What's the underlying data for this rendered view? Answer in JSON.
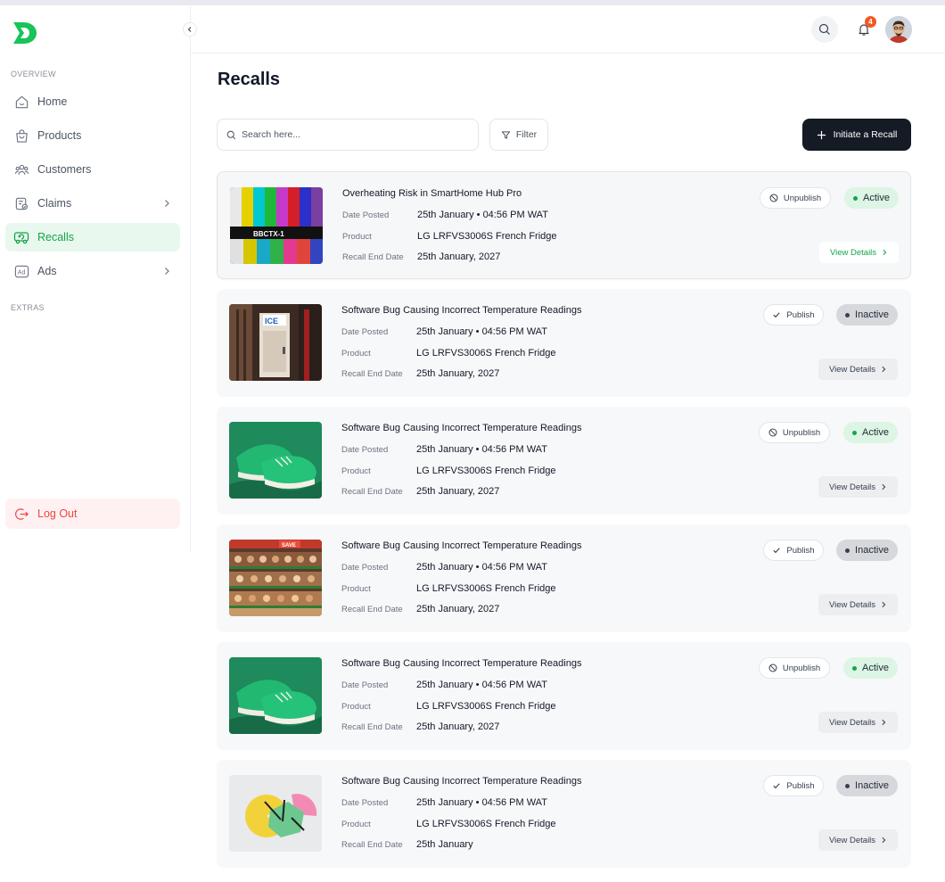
{
  "sidebar": {
    "overview_label": "OVERVIEW",
    "extras_label": "EXTRAS",
    "items": [
      {
        "label": "Home",
        "icon": "home-icon"
      },
      {
        "label": "Products",
        "icon": "bag-icon"
      },
      {
        "label": "Customers",
        "icon": "users-icon"
      },
      {
        "label": "Claims",
        "icon": "claims-icon"
      },
      {
        "label": "Recalls",
        "icon": "truck-icon"
      },
      {
        "label": "Ads",
        "icon": "ad-icon"
      }
    ],
    "logout_label": "Log Out"
  },
  "header": {
    "notification_count": "4"
  },
  "main": {
    "title": "Recalls",
    "search_placeholder": "Search here...",
    "filter_label": "Filter",
    "initiate_label": "Initiate a Recall",
    "labels": {
      "date_posted": "Date Posted",
      "product": "Product",
      "end_date": "Recall End Date"
    },
    "view_details_label": "View Details",
    "recalls": [
      {
        "title": "Overheating Risk in SmartHome Hub Pro",
        "date_posted": "25th January • 04:56 PM WAT",
        "product": "LG LRFVS3006S French Fridge",
        "end_date": "25th January, 2027",
        "action": "Unpublish",
        "status": "Active",
        "image": "test-pattern-image"
      },
      {
        "title": "Software Bug Causing Incorrect Temperature Readings",
        "date_posted": "25th January • 04:56 PM WAT",
        "product": "LG LRFVS3006S French Fridge",
        "end_date": "25th January, 2027",
        "action": "Publish",
        "status": "Inactive",
        "image": "ice-freezer-image"
      },
      {
        "title": "Software Bug Causing Incorrect Temperature Readings",
        "date_posted": "25th January • 04:56 PM WAT",
        "product": "LG LRFVS3006S French Fridge",
        "end_date": "25th January, 2027",
        "action": "Unpublish",
        "status": "Active",
        "image": "green-sneakers-image"
      },
      {
        "title": "Software Bug Causing Incorrect Temperature Readings",
        "date_posted": "25th January • 04:56 PM WAT",
        "product": "LG LRFVS3006S French Fridge",
        "end_date": "25th January, 2027",
        "action": "Publish",
        "status": "Inactive",
        "image": "grocery-shelves-image"
      },
      {
        "title": "Software Bug Causing Incorrect Temperature Readings",
        "date_posted": "25th January • 04:56 PM WAT",
        "product": "LG LRFVS3006S French Fridge",
        "end_date": "25th January, 2027",
        "action": "Unpublish",
        "status": "Active",
        "image": "green-sneakers-image"
      },
      {
        "title": "Software Bug Causing Incorrect Temperature Readings",
        "date_posted": "25th January • 04:56 PM WAT",
        "product": "LG LRFVS3006S French Fridge",
        "end_date": "25th January",
        "action": "Publish",
        "status": "Inactive",
        "image": "abstract-shapes-image"
      }
    ]
  },
  "colors": {
    "brand_green": "#16a34a",
    "primary_dark": "#151b24",
    "danger": "#ef4444",
    "badge_orange": "#f05a22"
  }
}
